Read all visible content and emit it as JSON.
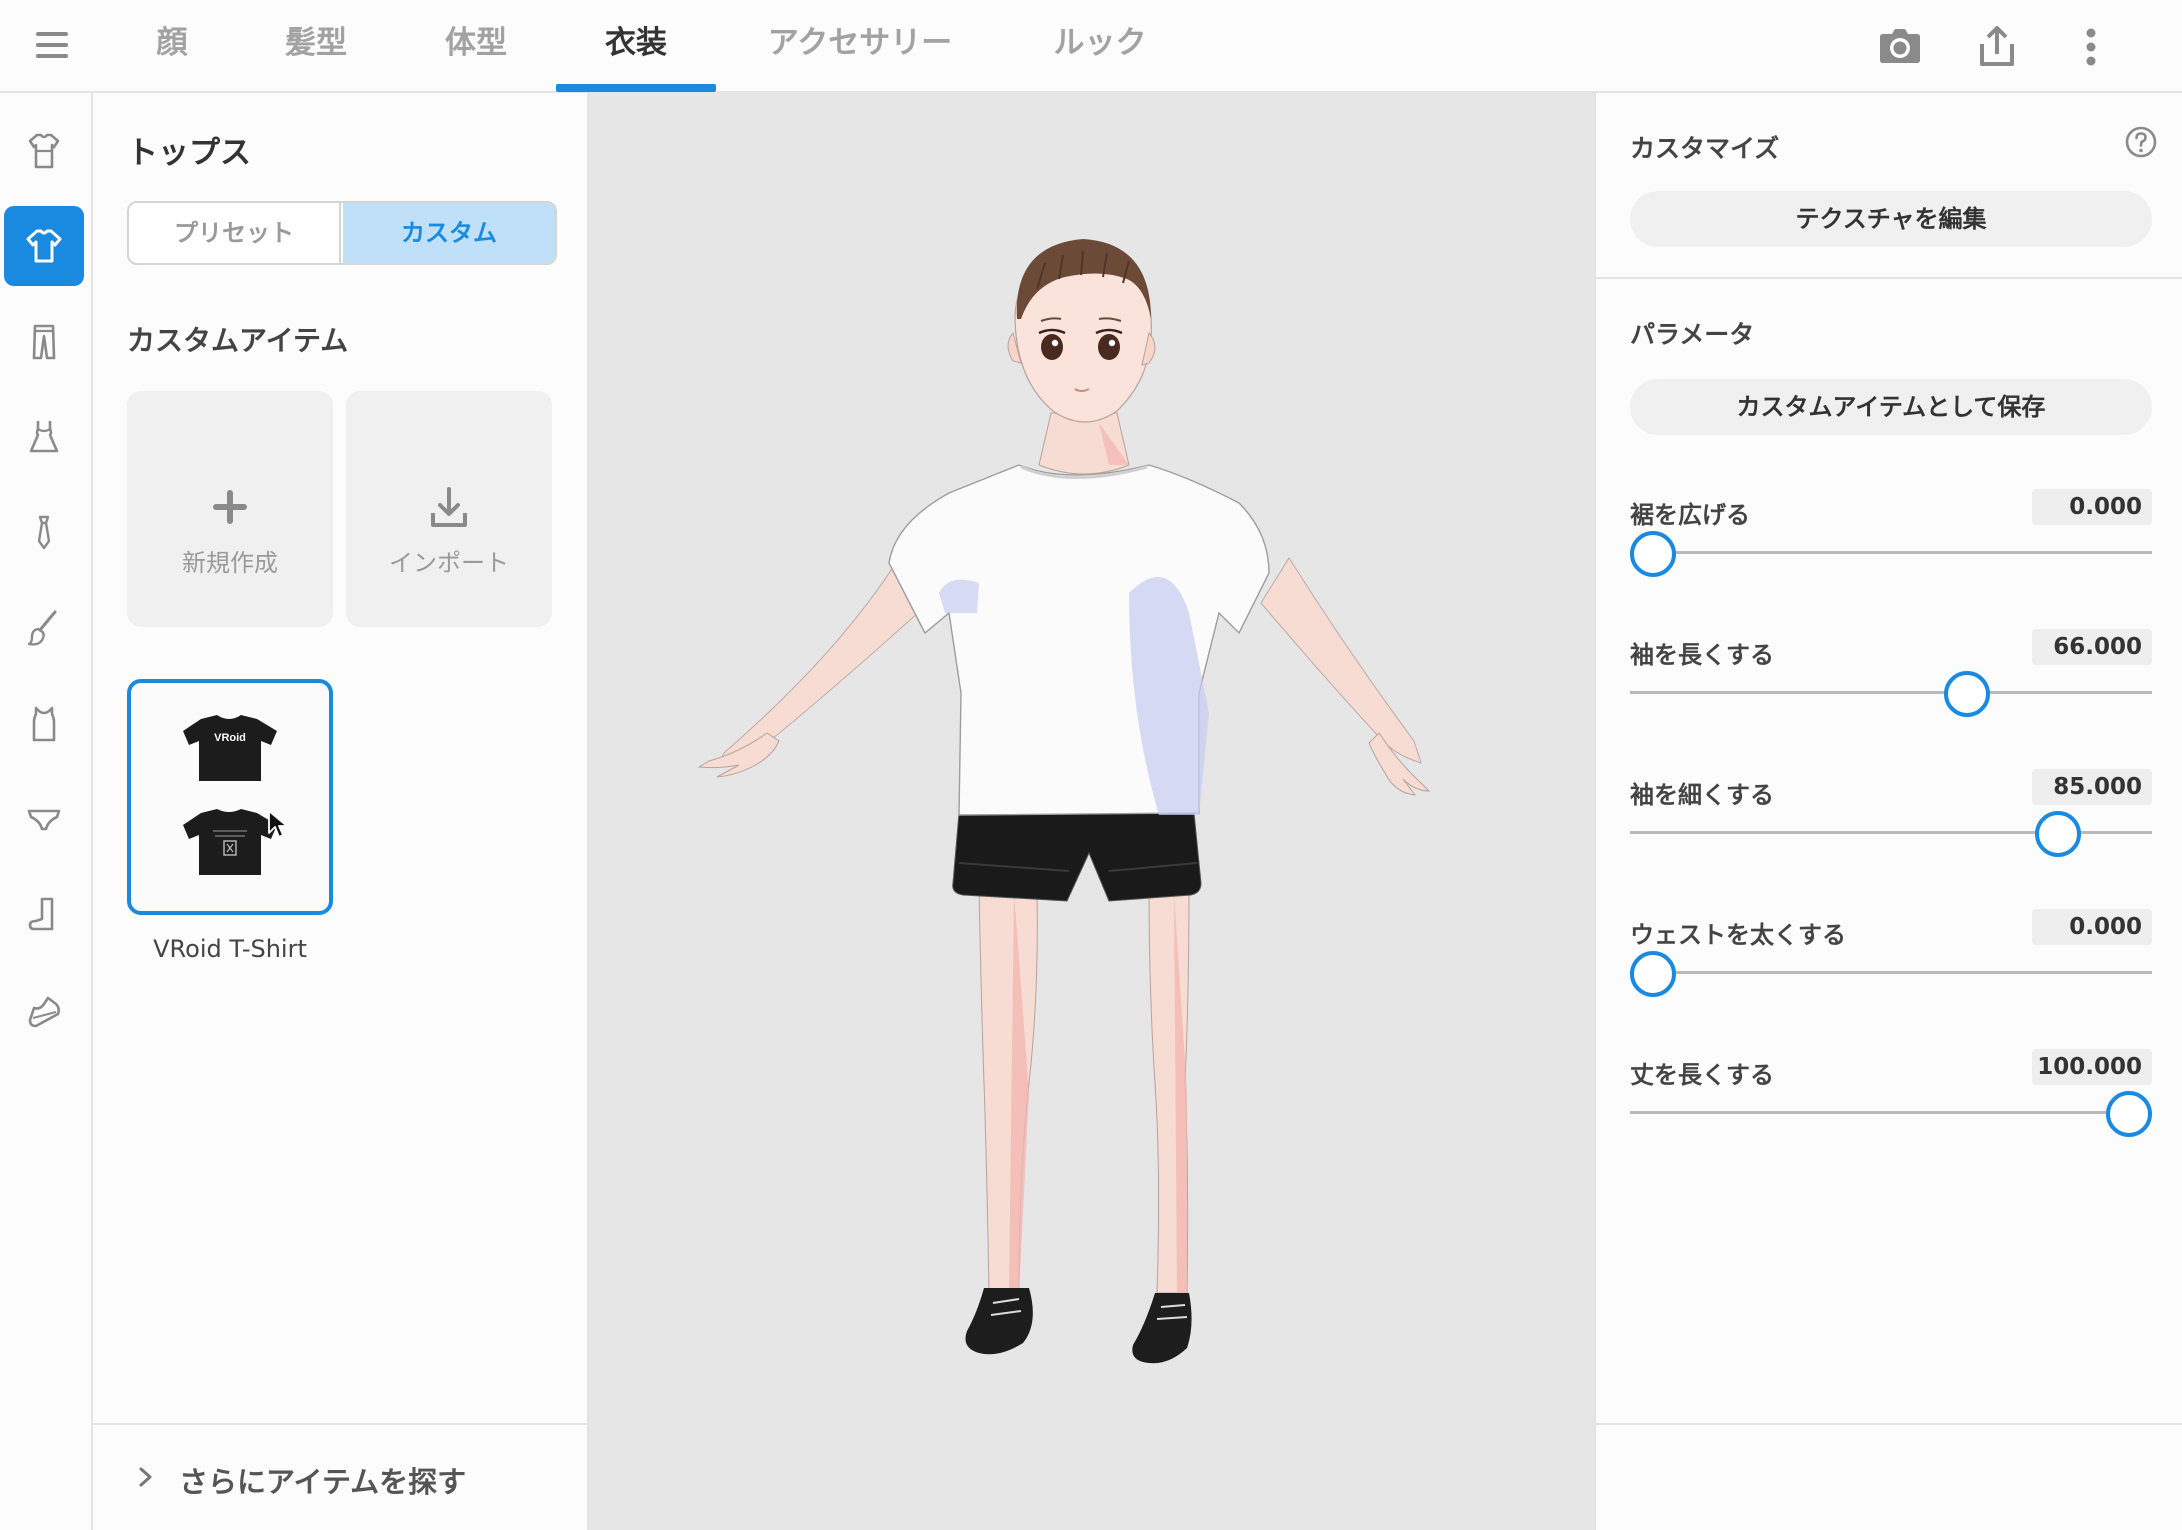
{
  "topbar": {
    "menu_icon": "hamburger-menu-icon",
    "tabs": [
      {
        "label": "顔"
      },
      {
        "label": "髪型"
      },
      {
        "label": "体型"
      },
      {
        "label": "衣装"
      },
      {
        "label": "アクセサリー"
      },
      {
        "label": "ルック"
      }
    ],
    "active_tab": "衣装",
    "actions": [
      "camera-icon",
      "share-export-icon",
      "more-vertical-icon"
    ]
  },
  "rail": {
    "items": [
      "onepiece-icon",
      "tops-icon",
      "pants-icon",
      "dress-icon",
      "tie-icon",
      "brush-icon",
      "tanktop-icon",
      "underwear-icon",
      "socks-icon",
      "shoes-icon"
    ],
    "active": "tops-icon"
  },
  "left_panel": {
    "title": "トップス",
    "segment": {
      "preset": "プリセット",
      "custom": "カスタム",
      "active": "カスタム"
    },
    "section_title": "カスタムアイテム",
    "new_label": "新規作成",
    "import_label": "インポート",
    "item": {
      "name": "VRoid T-Shirt",
      "shirt_text": "VRoid"
    },
    "find_more": "さらにアイテムを探す"
  },
  "right_panel": {
    "customize_title": "カスタマイズ",
    "edit_texture": "テクスチャを編集",
    "parameters_title": "パラメータ",
    "save_custom": "カスタムアイテムとして保存",
    "params": [
      {
        "label": "裾を広げる",
        "value": "0.000",
        "fraction": 0.0
      },
      {
        "label": "袖を長くする",
        "value": "66.000",
        "fraction": 0.66
      },
      {
        "label": "袖を細くする",
        "value": "85.000",
        "fraction": 0.85
      },
      {
        "label": "ウェストを太くする",
        "value": "0.000",
        "fraction": 0.0
      },
      {
        "label": "丈を長くする",
        "value": "100.000",
        "fraction": 1.0
      }
    ]
  },
  "colors": {
    "accent": "#1a8ae0",
    "segment_active_bg": "#bfe0f8",
    "viewport_bg": "#e6e6e6"
  }
}
